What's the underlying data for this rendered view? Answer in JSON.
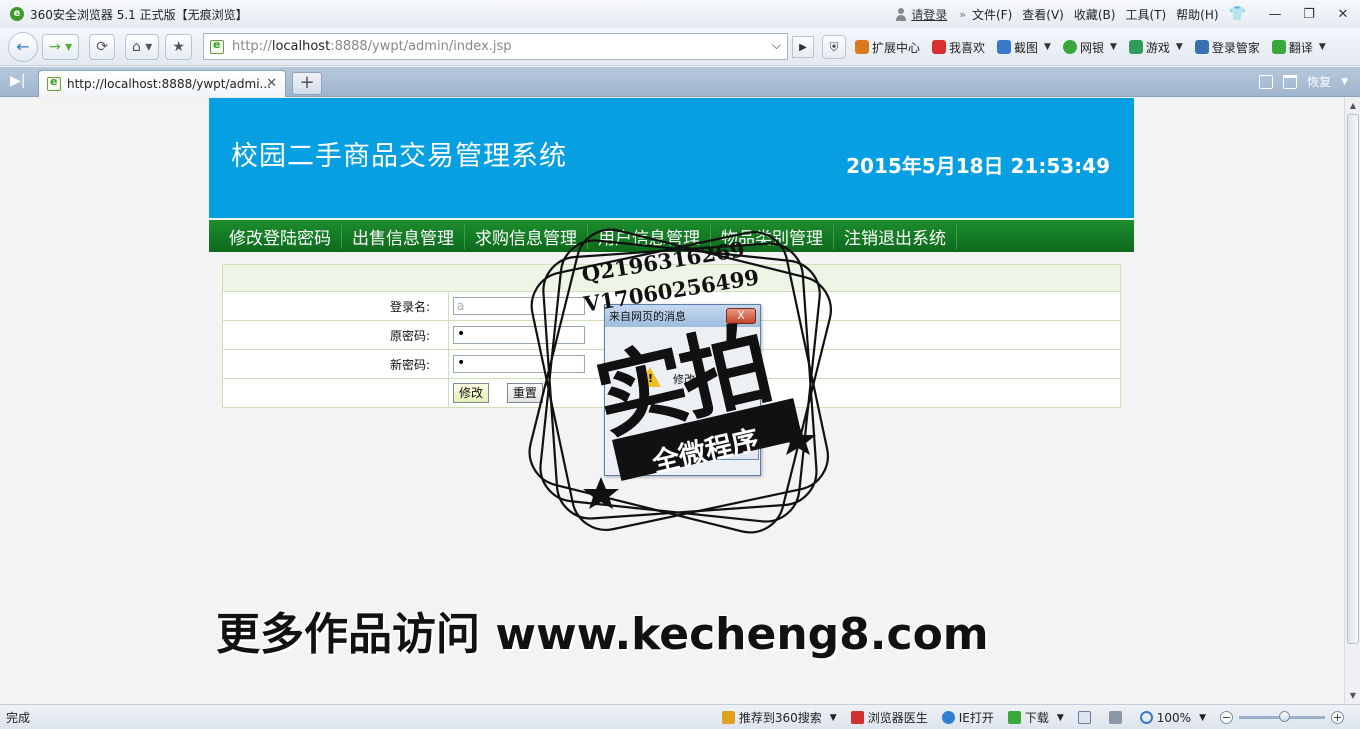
{
  "window": {
    "title": "360安全浏览器 5.1 正式版【无痕浏览】",
    "login_link": "请登录",
    "menu": [
      "文件(F)",
      "查看(V)",
      "收藏(B)",
      "工具(T)",
      "帮助(H)"
    ]
  },
  "address_bar": {
    "scheme": "http://",
    "host": "localhost",
    "rest": ":8888/ywpt/admin/index.jsp"
  },
  "toolbar": {
    "items": [
      {
        "label": "扩展中心",
        "color": "#d97a1c",
        "dropdown": false
      },
      {
        "label": "我喜欢",
        "color": "#d93030",
        "dropdown": false
      },
      {
        "label": "截图",
        "color": "#3a78c9",
        "dropdown": true
      },
      {
        "label": "网银",
        "color": "#3aa83a",
        "dropdown": true
      },
      {
        "label": "游戏",
        "color": "#2f9e5a",
        "dropdown": true
      },
      {
        "label": "登录管家",
        "color": "#3a6fb0",
        "dropdown": false
      },
      {
        "label": "翻译",
        "color": "#3aa83a",
        "dropdown": true
      }
    ]
  },
  "tabs": {
    "active_title": "http://localhost:8888/ywpt/admi...",
    "restore_label": "恢复"
  },
  "site": {
    "title": "校园二手商品交易管理系统",
    "clock": "2015年5月18日  21:53:49",
    "menu": [
      "修改登陆密码",
      "出售信息管理",
      "求购信息管理",
      "用户信息管理",
      "物品类别管理",
      "注销退出系统"
    ]
  },
  "form": {
    "username_label": "登录名:",
    "username_value": "a",
    "old_password_label": "原密码:",
    "old_password_value": "•",
    "new_password_label": "新密码:",
    "new_password_value": "•",
    "submit_label": "修改",
    "reset_label": "重置"
  },
  "dialog": {
    "title": "来自网页的消息",
    "message": "修改",
    "close_label": "X"
  },
  "watermark": {
    "qq": "Q2196316269",
    "v": "V17060256499",
    "big": "实拍",
    "ribbon": "全微程序",
    "promo": "更多作品访问 www.kecheng8.com"
  },
  "status": {
    "left": "完成",
    "items": [
      {
        "label": "推荐到360搜索",
        "color": "#e0a020"
      },
      {
        "label": "浏览器医生",
        "color": "#d03030"
      },
      {
        "label": "IE打开",
        "color": "#2f7fd0"
      },
      {
        "label": "下载",
        "color": "#3aa83a"
      }
    ],
    "zoom": "100%"
  }
}
